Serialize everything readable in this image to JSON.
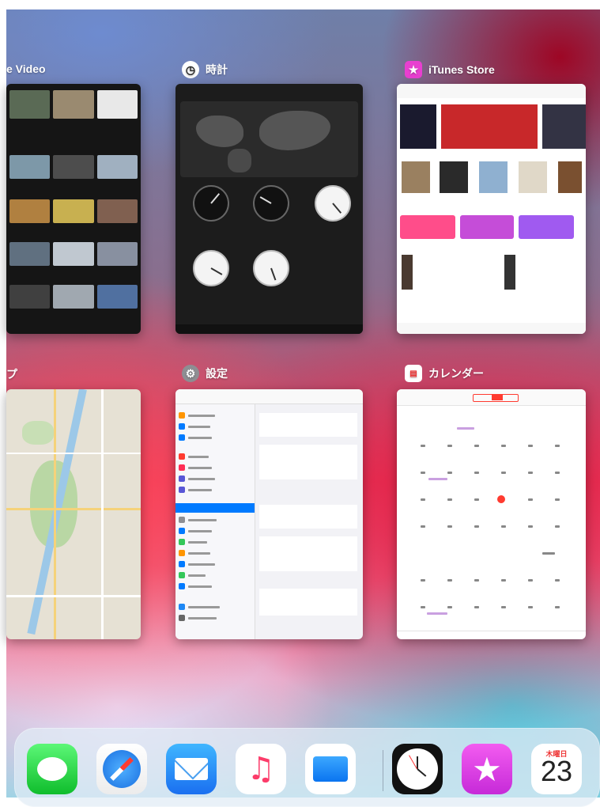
{
  "switcher": {
    "apps": [
      {
        "id": "video",
        "title": "e Video"
      },
      {
        "id": "clock",
        "title": "時計"
      },
      {
        "id": "itunes",
        "title": "iTunes Store"
      },
      {
        "id": "maps",
        "title": "プ"
      },
      {
        "id": "settings",
        "title": "設定"
      },
      {
        "id": "calendar",
        "title": "カレンダー"
      }
    ]
  },
  "dock": {
    "icons": [
      "messages-icon",
      "safari-icon",
      "mail-icon",
      "music-icon",
      "files-icon",
      "clock-icon",
      "itunes-store-icon",
      "calendar-icon"
    ],
    "calendar_weekday": "木曜日",
    "calendar_day": "23"
  },
  "colors": {
    "accent_red": "#ff3b30",
    "itunes_pink": "#e83fd0",
    "messages_green": "#34c759",
    "mail_blue": "#1e88f5",
    "files_blue": "#1a8cff"
  }
}
